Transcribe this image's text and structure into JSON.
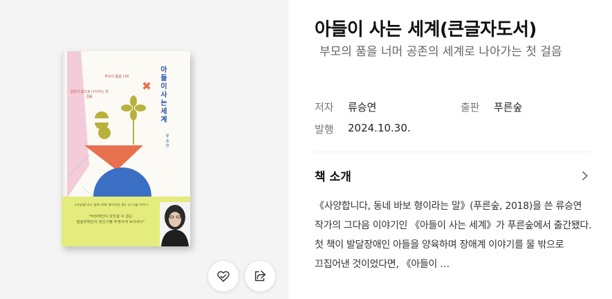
{
  "cover": {
    "title_vertical": "아들이 사는 세계",
    "author_vertical": "류승연",
    "tagline_a": "부모의 품을 너머",
    "tagline_b": "공존의 삶으로 나아가는 첫 걸음",
    "band_line_1": "《사양합니다, 동네 바보 형이라는 말》의 다음 이야기",
    "band_line_2": "\"비장애인이 상상할 수 없는",
    "band_line_3": "발달장애인의 성인기를 투명하게 묘사하다\"",
    "band_line_4": "",
    "colors": {
      "band": "#e3ec7c",
      "blue": "#3a6fc3",
      "orange": "#e8704f",
      "olive": "#b9b23a",
      "pink": "#f3c6d6"
    }
  },
  "actions": {
    "like_icon": "heart-icon",
    "share_icon": "share-icon"
  },
  "book": {
    "title": "아들이 사는 세계(큰글자도서)",
    "subtitle": "부모의 품을 너머 공존의 세계로 나아가는 첫 걸음",
    "author_label": "저자",
    "author": "류승연",
    "publisher_label": "출판",
    "publisher": "푸른숲",
    "date_label": "발행",
    "date": "2024.10.30."
  },
  "intro": {
    "heading": "책 소개",
    "text": "《사양합니다, 동네 바보 형이라는 말》(푸른숲, 2018)을 쓴 류승연 작가의 그다음 이야기인 《아들이 사는 세계》가 푸른숲에서 출간됐다. 첫 책이 발달장애인 아들을 양육하며 장애계 이야기를 물 밖으로 끄집어낸 것이었다면, 《아들이 …"
  }
}
